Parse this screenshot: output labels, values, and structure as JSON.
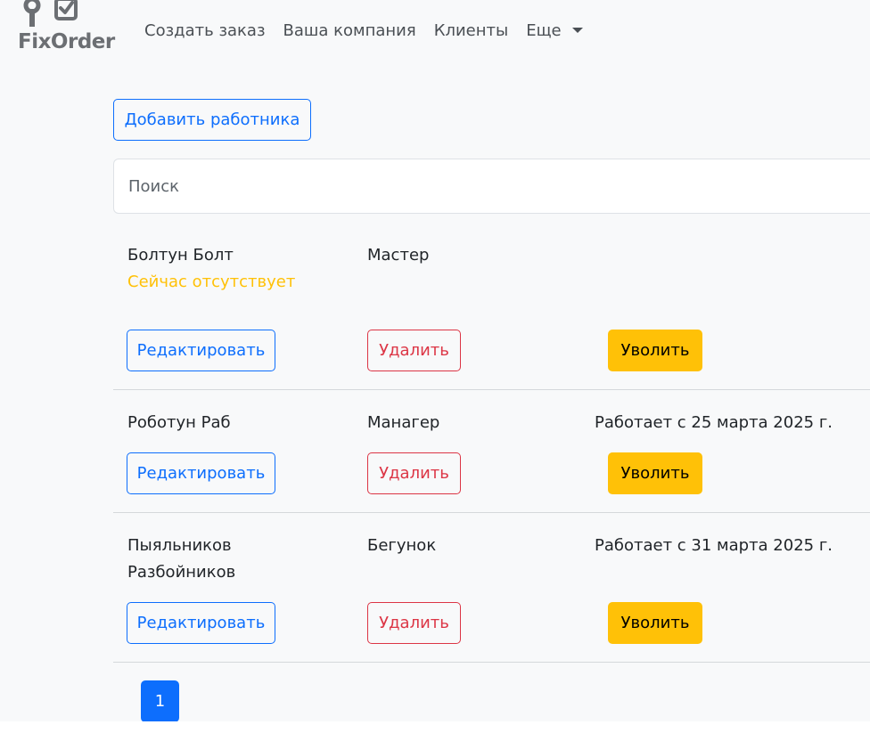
{
  "brand": {
    "name": "FixOrder"
  },
  "nav": {
    "items": [
      "Создать заказ",
      "Ваша компания",
      "Клиенты"
    ],
    "more_label": "Еще"
  },
  "toolbar": {
    "add_employee_label": "Добавить работника"
  },
  "search": {
    "placeholder": "Поиск",
    "value": ""
  },
  "employees": [
    {
      "name_line1": "Болтун Болт",
      "name_line2": "",
      "status": "Сейчас отсутствует",
      "role": "Мастер",
      "since": "",
      "edit_label": "Редактировать",
      "delete_label": "Удалить",
      "fire_label": "Уволить"
    },
    {
      "name_line1": "Роботун Раб",
      "name_line2": "",
      "status": "",
      "role": "Манагер",
      "since": "Работает с 25 марта 2025 г.",
      "edit_label": "Редактировать",
      "delete_label": "Удалить",
      "fire_label": "Уволить"
    },
    {
      "name_line1": "Пыяльников",
      "name_line2": "Разбойников",
      "status": "",
      "role": "Бегунок",
      "since": "Работает с 31 марта 2025 г.",
      "edit_label": "Редактировать",
      "delete_label": "Удалить",
      "fire_label": "Уволить"
    }
  ],
  "pagination": {
    "current_page": "1"
  },
  "colors": {
    "primary": "#0d6efd",
    "danger": "#dc3545",
    "warning": "#ffc107",
    "background": "#f8f9fa"
  }
}
